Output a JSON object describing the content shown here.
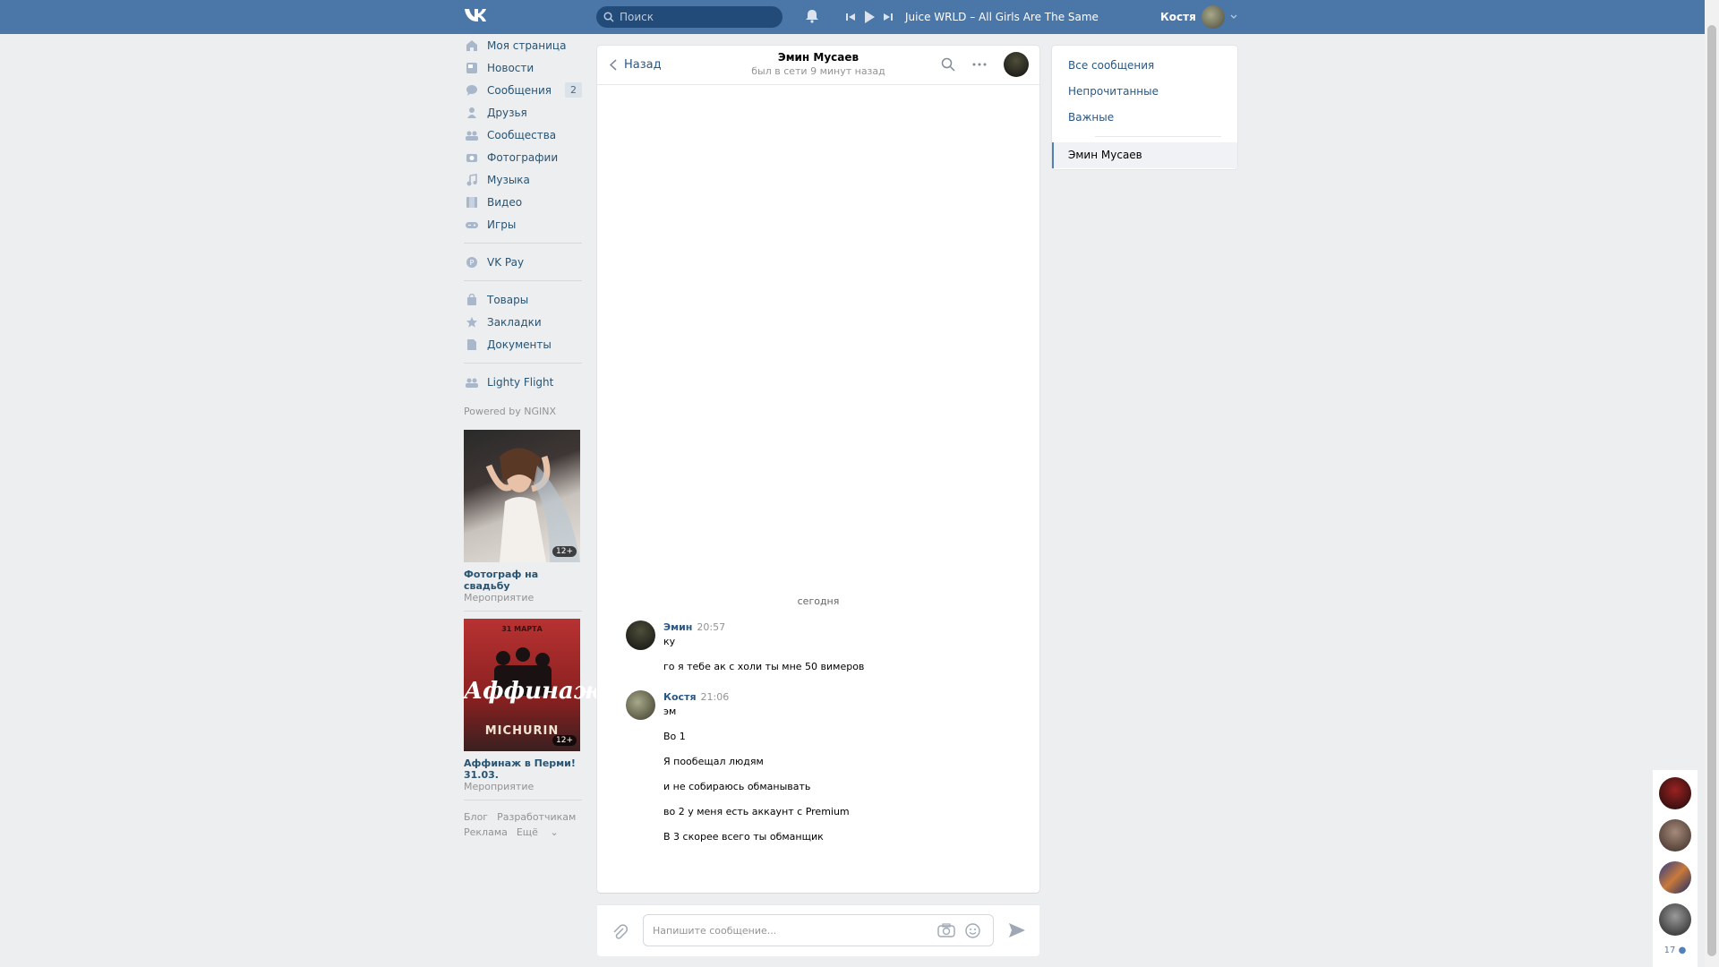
{
  "header": {
    "search_placeholder": "Поиск",
    "track": "Juice WRLD – All Girls Are The Same",
    "user_name": "Костя"
  },
  "nav": {
    "items": [
      {
        "label": "Моя страница",
        "icon": "home-icon"
      },
      {
        "label": "Новости",
        "icon": "news-icon"
      },
      {
        "label": "Сообщения",
        "icon": "messages-icon",
        "badge": "2"
      },
      {
        "label": "Друзья",
        "icon": "friends-icon"
      },
      {
        "label": "Сообщества",
        "icon": "groups-icon"
      },
      {
        "label": "Фотографии",
        "icon": "camera-icon"
      },
      {
        "label": "Музыка",
        "icon": "music-icon"
      },
      {
        "label": "Видео",
        "icon": "video-icon"
      },
      {
        "label": "Игры",
        "icon": "games-icon"
      }
    ],
    "vkpay": "VK Pay",
    "group2": [
      {
        "label": "Товары",
        "icon": "bag-icon"
      },
      {
        "label": "Закладки",
        "icon": "star-icon"
      },
      {
        "label": "Документы",
        "icon": "document-icon"
      }
    ],
    "app": "Lighty Flight",
    "powered": "Powered by NGINX"
  },
  "ads": [
    {
      "age": "12+",
      "title": "Фотограф на свадьбу",
      "subtitle": "Мероприятие"
    },
    {
      "age": "12+",
      "title": "Аффинаж в Перми! 31.03.",
      "subtitle": "Мероприятие",
      "poster_top": "31 МАРТА",
      "poster_main": "Аффинаж",
      "poster_bottom": "MICHURIN"
    }
  ],
  "footer": {
    "blog": "Блог",
    "devs": "Разработчикам",
    "ads": "Реклама",
    "more": "Ещё"
  },
  "chat": {
    "back": "Назад",
    "peer_name": "Эмин Мусаев",
    "peer_status": "был в сети 9 минут назад",
    "date": "сегодня",
    "messages": [
      {
        "author": "Эмин",
        "time": "20:57",
        "lines": [
          "ку",
          "го я тебе ак с холи ты мне 50 вимеров"
        ]
      },
      {
        "author": "Костя",
        "time": "21:06",
        "lines": [
          "эм",
          "Во 1",
          "Я пообещал людям",
          "и не собираюсь обманывать",
          "во 2 у меня есть аккаунт с Premium",
          "В 3 скорее всего ты обманщик"
        ]
      }
    ],
    "composer_placeholder": "Напишите сообщение..."
  },
  "filters": {
    "all": "Все сообщения",
    "unread": "Непрочитанные",
    "important": "Важные",
    "active_chat": "Эмин Мусаев"
  },
  "rail": {
    "count": "17"
  }
}
